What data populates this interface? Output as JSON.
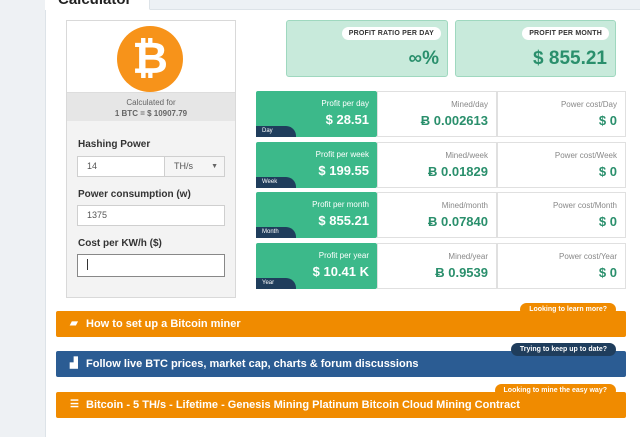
{
  "tab": {
    "title": "Calculator"
  },
  "left": {
    "calc_line1": "Calculated for",
    "calc_line2": "1 BTC = $ 10907.79",
    "hashing_label": "Hashing Power",
    "hashing_value": "14",
    "hashing_unit": "TH/s",
    "power_label": "Power consumption (w)",
    "power_value": "1375",
    "cost_label": "Cost per KW/h ($)",
    "cost_value": ""
  },
  "ratios": [
    {
      "label": "PROFIT RATIO PER DAY",
      "value": "∞%"
    },
    {
      "label": "PROFIT PER MONTH",
      "value": "$ 855.21"
    }
  ],
  "rows": [
    {
      "tag": "Day",
      "profit_label": "Profit per day",
      "profit": "$ 28.51",
      "mined_label": "Mined/day",
      "mined": "Ƀ 0.002613",
      "power_label": "Power cost/Day",
      "power": "$ 0"
    },
    {
      "tag": "Week",
      "profit_label": "Profit per week",
      "profit": "$ 199.55",
      "mined_label": "Mined/week",
      "mined": "Ƀ 0.01829",
      "power_label": "Power cost/Week",
      "power": "$ 0"
    },
    {
      "tag": "Month",
      "profit_label": "Profit per month",
      "profit": "$ 855.21",
      "mined_label": "Mined/month",
      "mined": "Ƀ 0.07840",
      "power_label": "Power cost/Month",
      "power": "$ 0"
    },
    {
      "tag": "Year",
      "profit_label": "Profit per year",
      "profit": "$ 10.41 K",
      "mined_label": "Mined/year",
      "mined": "Ƀ 0.9539",
      "power_label": "Power cost/Year",
      "power": "$ 0"
    }
  ],
  "banners": [
    {
      "text": "How to set up a Bitcoin miner",
      "tag": "Looking to learn more?",
      "color": "#f08b00",
      "icon": "book-icon"
    },
    {
      "text": "Follow live BTC prices, market cap, charts & forum discussions",
      "tag": "Trying to keep up to date?",
      "color": "#2b5c93",
      "icon": "chart-icon"
    },
    {
      "text": "Bitcoin - 5 TH/s - Lifetime - Genesis Mining Platinum Bitcoin Cloud Mining Contract",
      "tag": "Looking to mine the easy way?",
      "color": "#f08b00",
      "icon": "list-icon"
    }
  ]
}
